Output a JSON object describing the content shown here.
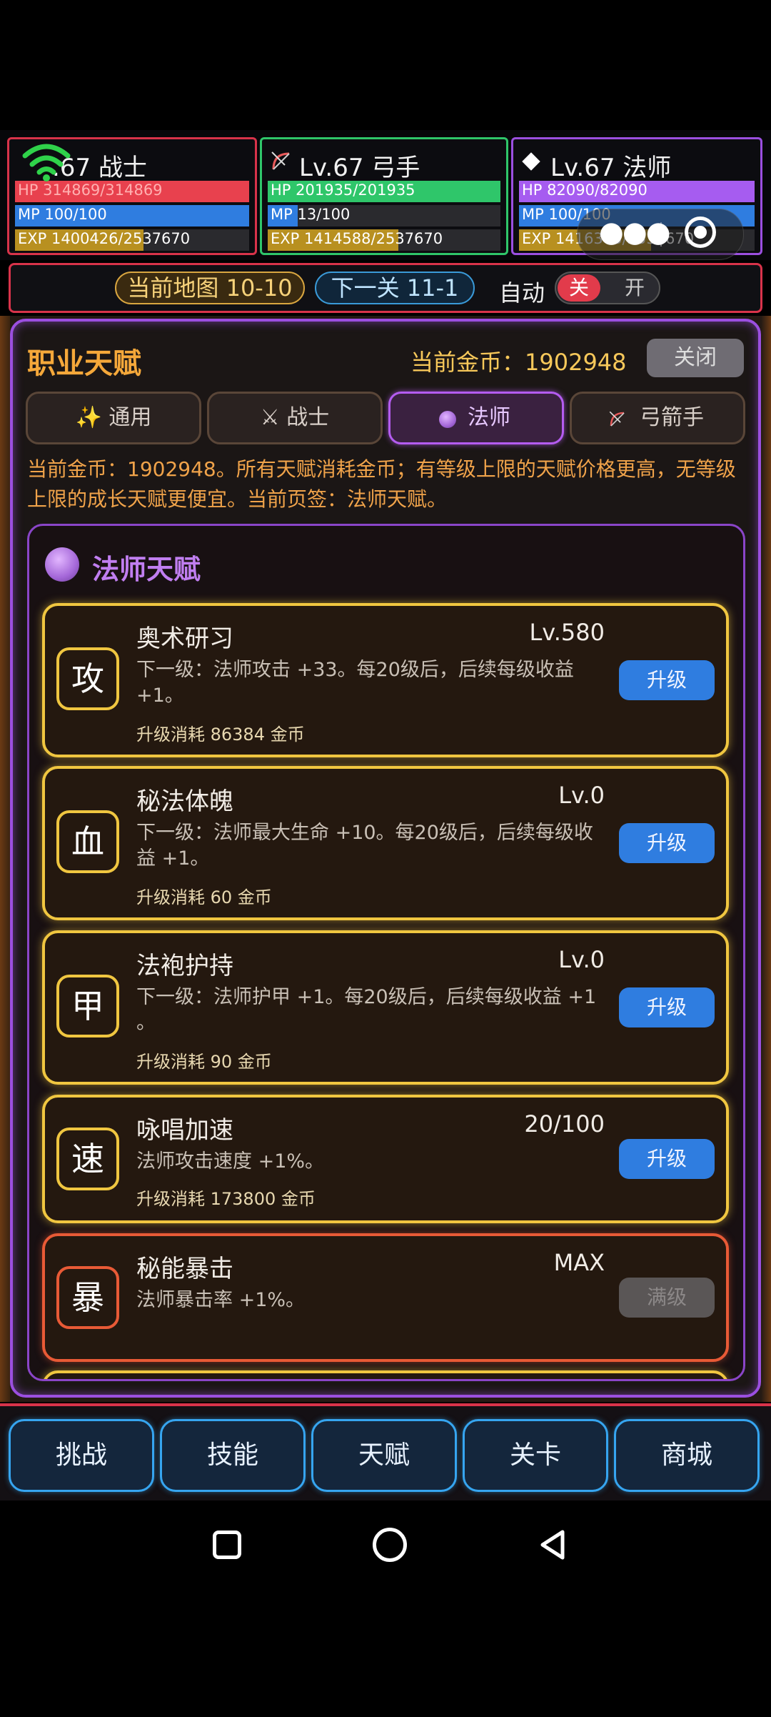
{
  "party": [
    {
      "name": ".67 战士",
      "hp": "HP 314869/314869",
      "hp_frac": 1.0,
      "mp": "MP 100/100",
      "mp_frac": 1.0,
      "exp": "EXP 1400426/2537670",
      "exp_frac": 0.552,
      "color": "#d8334a",
      "icon": "crossed-swords-icon"
    },
    {
      "name": "Lv.67 弓手",
      "hp": "HP 201935/201935",
      "hp_frac": 1.0,
      "mp": "MP 13/100",
      "mp_frac": 0.13,
      "exp": "EXP 1414588/2537670",
      "exp_frac": 0.557,
      "color": "#2fc66a",
      "icon": "bow-icon"
    },
    {
      "name": "Lv.67 法师",
      "hp": "HP 82090/82090",
      "hp_frac": 1.0,
      "mp": "MP 100/100",
      "mp_frac": 1.0,
      "exp": "EXP 1416303/2537670",
      "exp_frac": 0.558,
      "color": "#9b4fe0",
      "icon": "diamond-icon"
    }
  ],
  "mapbar": {
    "current_map": "当前地图 10-10",
    "next_stage": "下一关 11-1",
    "auto_label": "自动",
    "auto_off": "关",
    "auto_on": "开"
  },
  "panel": {
    "title": "职业天赋",
    "gold": "当前金币：1902948",
    "close": "关闭",
    "tabs": [
      "✨ 通用",
      "⚔ 战士",
      "法师",
      "弓箭手"
    ],
    "description": "当前金币：1902948。所有天赋消耗金币；有等级上限的天赋价格更高，无等级上限的成长天赋更便宜。当前页签：法师天赋。",
    "section_title": "法师天赋"
  },
  "talents": [
    {
      "icon": "攻",
      "name": "奥术研习",
      "level": "Lv.580",
      "desc": "下一级：法师攻击 +33。每20级后，后续每级收益 +1。",
      "cost": "升级消耗 86384 金币",
      "button": "升级",
      "maxed": false
    },
    {
      "icon": "血",
      "name": "秘法体魄",
      "level": "Lv.0",
      "desc": "下一级：法师最大生命 +10。每20级后，后续每级收益 +1。",
      "cost": "升级消耗 60 金币",
      "button": "升级",
      "maxed": false
    },
    {
      "icon": "甲",
      "name": "法袍护持",
      "level": "Lv.0",
      "desc": "下一级：法师护甲 +1。每20级后，后续每级收益 +1 。",
      "cost": "升级消耗 90 金币",
      "button": "升级",
      "maxed": false
    },
    {
      "icon": "速",
      "name": "咏唱加速",
      "level": "20/100",
      "desc": "法师攻击速度 +1%。",
      "cost": "升级消耗 173800 金币",
      "button": "升级",
      "maxed": false
    },
    {
      "icon": "暴",
      "name": "秘能暴击",
      "level": "MAX",
      "desc": "法师暴击率 +1%。",
      "cost": "",
      "button": "满级",
      "maxed": true
    }
  ],
  "nav": [
    "挑战",
    "技能",
    "天赋",
    "关卡",
    "商城"
  ]
}
